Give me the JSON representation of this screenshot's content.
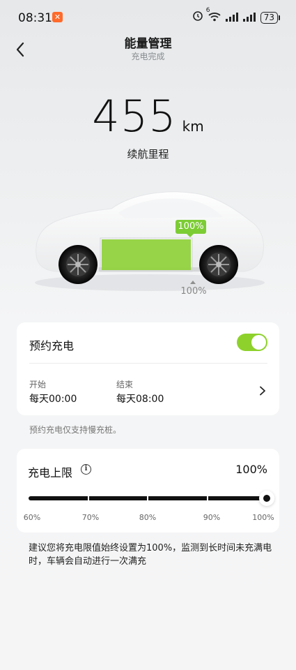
{
  "status_bar": {
    "time": "08:31",
    "battery": "73",
    "wifi_label": "6"
  },
  "header": {
    "title": "能量管理",
    "subtitle": "充电完成"
  },
  "range": {
    "value": "455",
    "unit": "km",
    "label": "续航里程"
  },
  "battery": {
    "level_percent": 100,
    "badge": "100%",
    "limit_marker": "100%",
    "fill_color": "#8fd13a"
  },
  "schedule": {
    "title": "预约充电",
    "enabled": true,
    "start_label": "开始",
    "start_value": "每天00:00",
    "end_label": "结束",
    "end_value": "每天08:00",
    "note": "预约充电仅支持慢充桩。"
  },
  "charge_limit": {
    "title": "充电上限",
    "value": "100%",
    "slider_fraction": 1.0,
    "ticks": [
      "60%",
      "70%",
      "80%",
      "90%",
      "100%"
    ]
  },
  "advice": "建议您将充电限值始终设置为100%，监测到长时间未充满电时，车辆会自动进行一次满充",
  "colors": {
    "accent_green": "#8ed12c",
    "badge_green": "#7ccc34",
    "app_badge": "#ff6a2b"
  }
}
